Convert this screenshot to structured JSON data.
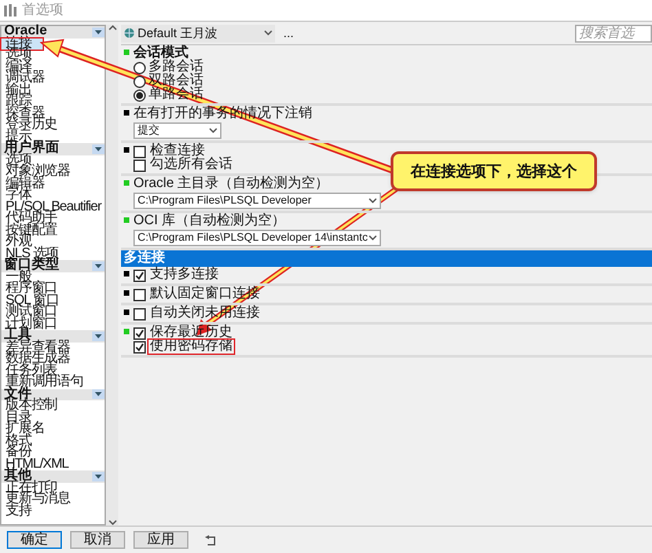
{
  "window": {
    "title": "首选项"
  },
  "sidebar": {
    "groups": [
      {
        "title": "Oracle",
        "items": [
          {
            "label": "连接",
            "selected": true,
            "highlighted": true
          },
          {
            "label": "选项",
            "selected": false
          },
          {
            "label": "编译",
            "selected": false
          },
          {
            "label": "调试器",
            "selected": false
          },
          {
            "label": "输出",
            "selected": false
          },
          {
            "label": "跟踪",
            "selected": false
          },
          {
            "label": "探查器",
            "selected": false
          },
          {
            "label": "登录历史",
            "selected": false
          },
          {
            "label": "提示",
            "selected": false
          }
        ]
      },
      {
        "title": "用户界面",
        "items": [
          {
            "label": "选项",
            "selected": false
          },
          {
            "label": "对象浏览器",
            "selected": false
          },
          {
            "label": "编辑器",
            "selected": false
          },
          {
            "label": "字体",
            "selected": false
          },
          {
            "label": "PL/SQL Beautifier",
            "selected": false
          },
          {
            "label": "代码助手",
            "selected": false
          },
          {
            "label": "按键配置",
            "selected": false
          },
          {
            "label": "外观",
            "selected": false
          },
          {
            "label": "NLS 选项",
            "selected": false
          }
        ]
      },
      {
        "title": "窗口类型",
        "items": [
          {
            "label": "一般",
            "selected": false
          },
          {
            "label": "程序窗口",
            "selected": false
          },
          {
            "label": "SQL 窗口",
            "selected": false
          },
          {
            "label": "测试窗口",
            "selected": false
          },
          {
            "label": "计划窗口",
            "selected": false
          }
        ]
      },
      {
        "title": "工具",
        "items": [
          {
            "label": "差异查看器",
            "selected": false
          },
          {
            "label": "数据生成器",
            "selected": false
          },
          {
            "label": "任务列表",
            "selected": false
          },
          {
            "label": "重新调用语句",
            "selected": false
          }
        ]
      },
      {
        "title": "文件",
        "items": [
          {
            "label": "版本控制",
            "selected": false
          },
          {
            "label": "目录",
            "selected": false
          },
          {
            "label": "扩展名",
            "selected": false
          },
          {
            "label": "格式",
            "selected": false
          },
          {
            "label": "备份",
            "selected": false
          },
          {
            "label": "HTML/XML",
            "selected": false
          }
        ]
      },
      {
        "title": "其他",
        "items": [
          {
            "label": "正在打印",
            "selected": false
          },
          {
            "label": "更新与消息",
            "selected": false
          },
          {
            "label": "支持",
            "selected": false
          }
        ]
      }
    ]
  },
  "toolbar": {
    "profile": "Default 王月波",
    "more": "...",
    "search": {
      "placeholder": "搜索首选"
    }
  },
  "sections": [
    {
      "kind": "radios",
      "color": "#22cc22",
      "title": "会话模式",
      "options": [
        {
          "label": "多路会话",
          "selected": false
        },
        {
          "label": "双路会话",
          "selected": false
        },
        {
          "label": "单路会话",
          "selected": true
        }
      ]
    },
    {
      "kind": "select",
      "color": "#000000",
      "title": "在有打开的事务的情况下注销",
      "value": "提交"
    },
    {
      "kind": "checks",
      "color": "#000000",
      "options": [
        {
          "label": "检查连接",
          "checked": false
        },
        {
          "label": "勾选所有会话",
          "checked": false
        }
      ]
    },
    {
      "kind": "select",
      "color": "#22cc22",
      "title": "Oracle 主目录（自动检测为空）",
      "value": "C:\\Program Files\\PLSQL Developer"
    },
    {
      "kind": "select",
      "color": "#22cc22",
      "title": "OCI 库（自动检测为空）",
      "value": "C:\\Program Files\\PLSQL Developer 14\\instantc"
    }
  ],
  "group_header": "多连接",
  "group_sections": [
    {
      "kind": "checks",
      "color": "#000000",
      "options": [
        {
          "label": "支持多连接",
          "checked": true
        }
      ]
    },
    {
      "kind": "checks",
      "color": "#000000",
      "options": [
        {
          "label": "默认固定窗口连接",
          "checked": false
        }
      ]
    },
    {
      "kind": "checks",
      "color": "#000000",
      "options": [
        {
          "label": "自动关闭未用连接",
          "checked": false
        }
      ]
    },
    {
      "kind": "checks",
      "color": "#22cc22",
      "options": [
        {
          "label": "保存最近历史",
          "checked": true
        },
        {
          "label": "使用密码存储",
          "checked": true,
          "highlighted": true
        }
      ]
    }
  ],
  "buttons": [
    {
      "label": "确定",
      "default": true
    },
    {
      "label": "取消",
      "default": false
    },
    {
      "label": "应用",
      "default": false
    }
  ],
  "callout": {
    "text": "在连接选项下，选择这个"
  }
}
